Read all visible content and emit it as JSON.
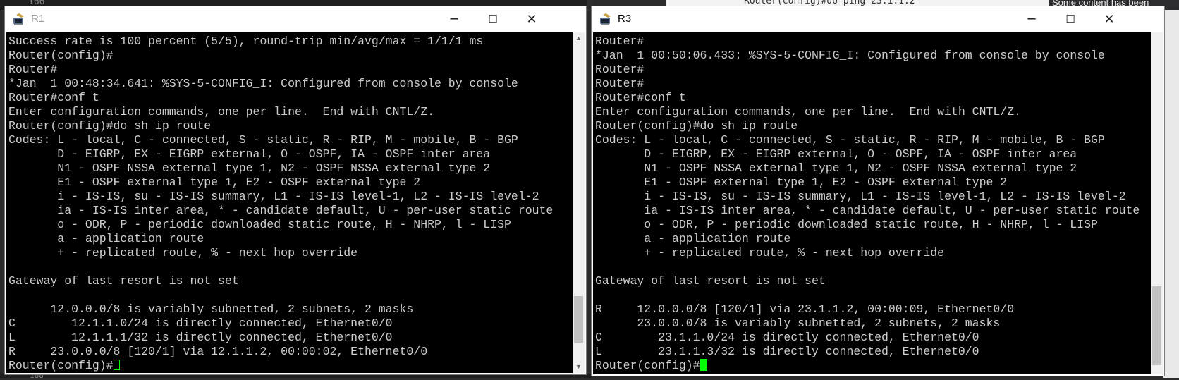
{
  "background": {
    "editor_line_top": "166",
    "editor_line_bottom": "188",
    "right_editor_text": "Router(config)#do ping 23.1.1.2",
    "notification": "Some content has been"
  },
  "window_r1": {
    "title": "R1",
    "active": false,
    "lines": [
      "Success rate is 100 percent (5/5), round-trip min/avg/max = 1/1/1 ms",
      "Router(config)#",
      "Router#",
      "*Jan  1 00:48:34.641: %SYS-5-CONFIG_I: Configured from console by console",
      "Router#conf t",
      "Enter configuration commands, one per line.  End with CNTL/Z.",
      "Router(config)#do sh ip route",
      "Codes: L - local, C - connected, S - static, R - RIP, M - mobile, B - BGP",
      "       D - EIGRP, EX - EIGRP external, O - OSPF, IA - OSPF inter area",
      "       N1 - OSPF NSSA external type 1, N2 - OSPF NSSA external type 2",
      "       E1 - OSPF external type 1, E2 - OSPF external type 2",
      "       i - IS-IS, su - IS-IS summary, L1 - IS-IS level-1, L2 - IS-IS level-2",
      "       ia - IS-IS inter area, * - candidate default, U - per-user static route",
      "       o - ODR, P - periodic downloaded static route, H - NHRP, l - LISP",
      "       a - application route",
      "       + - replicated route, % - next hop override",
      "",
      "Gateway of last resort is not set",
      "",
      "      12.0.0.0/8 is variably subnetted, 2 subnets, 2 masks",
      "C        12.1.1.0/24 is directly connected, Ethernet0/0",
      "L        12.1.1.1/32 is directly connected, Ethernet0/0",
      "R     23.0.0.0/8 [120/1] via 12.1.1.2, 00:00:02, Ethernet0/0"
    ],
    "prompt": "Router(config)#"
  },
  "window_r3": {
    "title": "R3",
    "active": true,
    "lines": [
      "Router#",
      "*Jan  1 00:50:06.433: %SYS-5-CONFIG_I: Configured from console by console",
      "Router#",
      "Router#",
      "Router#conf t",
      "Enter configuration commands, one per line.  End with CNTL/Z.",
      "Router(config)#do sh ip route",
      "Codes: L - local, C - connected, S - static, R - RIP, M - mobile, B - BGP",
      "       D - EIGRP, EX - EIGRP external, O - OSPF, IA - OSPF inter area",
      "       N1 - OSPF NSSA external type 1, N2 - OSPF NSSA external type 2",
      "       E1 - OSPF external type 1, E2 - OSPF external type 2",
      "       i - IS-IS, su - IS-IS summary, L1 - IS-IS level-1, L2 - IS-IS level-2",
      "       ia - IS-IS inter area, * - candidate default, U - per-user static route",
      "       o - ODR, P - periodic downloaded static route, H - NHRP, l - LISP",
      "       a - application route",
      "       + - replicated route, % - next hop override",
      "",
      "Gateway of last resort is not set",
      "",
      "R     12.0.0.0/8 [120/1] via 23.1.1.2, 00:00:09, Ethernet0/0",
      "      23.0.0.0/8 is variably subnetted, 2 subnets, 2 masks",
      "C        23.1.1.0/24 is directly connected, Ethernet0/0",
      "L        23.1.1.3/32 is directly connected, Ethernet0/0"
    ],
    "prompt": "Router(config)#"
  },
  "window_controls": {
    "minimize": "─",
    "maximize": "☐",
    "close": "✕"
  },
  "colors": {
    "terminal_bg": "#000000",
    "terminal_fg": "#cccccc",
    "cursor": "#00ff00"
  }
}
